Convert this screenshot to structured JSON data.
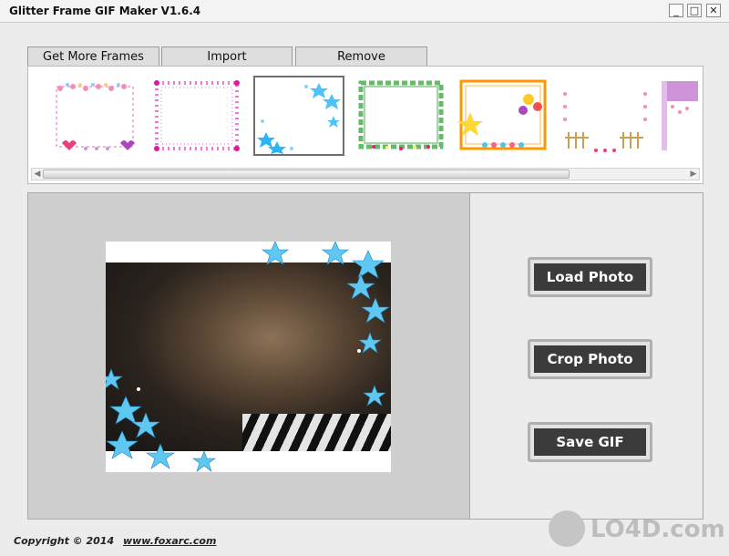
{
  "window": {
    "title": "Glitter Frame GIF Maker V1.6.4",
    "controls": {
      "minimize": "_",
      "maximize": "□",
      "close": "✕"
    }
  },
  "tabs": [
    {
      "label": "Get More Frames"
    },
    {
      "label": "Import"
    },
    {
      "label": "Remove"
    }
  ],
  "frames": {
    "items": [
      {
        "name": "pastel-hearts-frame"
      },
      {
        "name": "pink-dots-frame"
      },
      {
        "name": "blue-flowers-corner-frame",
        "selected": true
      },
      {
        "name": "green-vines-frame"
      },
      {
        "name": "star-balloons-frame"
      },
      {
        "name": "pink-fence-frame"
      },
      {
        "name": "purple-sparkle-frame"
      }
    ],
    "scrollbar": {
      "left_arrow": "◀",
      "right_arrow": "▶"
    }
  },
  "actions": {
    "load": "Load Photo",
    "crop": "Crop Photo",
    "save": "Save GIF"
  },
  "footer": {
    "copyright": "Copyright © 2014",
    "link": "www.foxarc.com"
  },
  "watermark": "LO4D.com"
}
